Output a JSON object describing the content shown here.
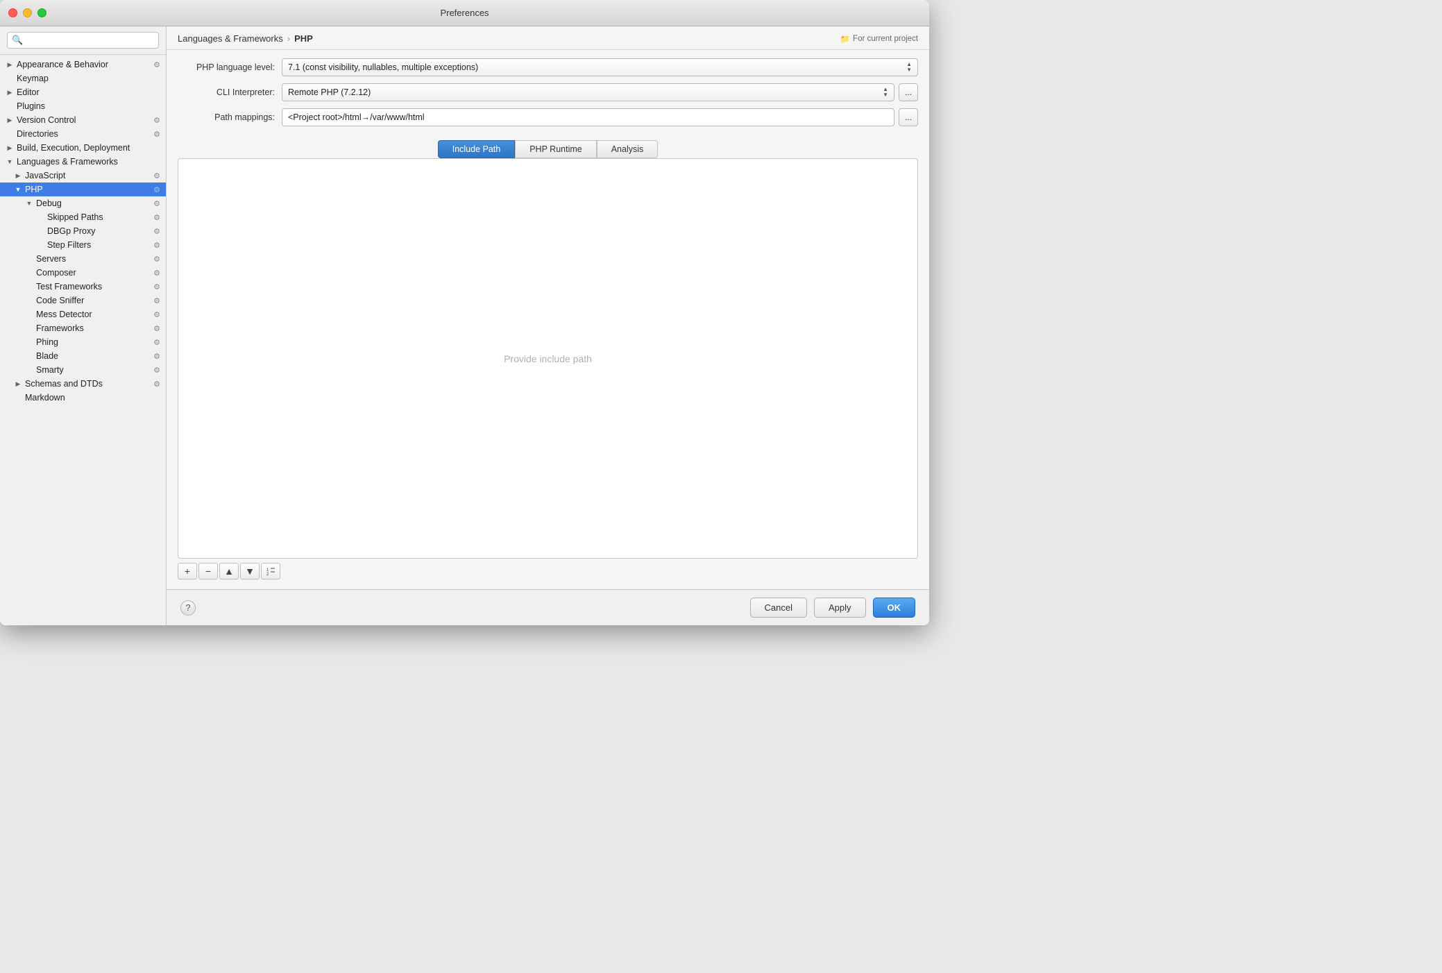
{
  "window": {
    "title": "Preferences"
  },
  "sidebar": {
    "search_placeholder": "🔍",
    "items": [
      {
        "id": "appearance",
        "label": "Appearance & Behavior",
        "level": 0,
        "arrow": "▶",
        "has_icon": true
      },
      {
        "id": "keymap",
        "label": "Keymap",
        "level": 0,
        "arrow": "",
        "has_icon": false
      },
      {
        "id": "editor",
        "label": "Editor",
        "level": 0,
        "arrow": "▶",
        "has_icon": false
      },
      {
        "id": "plugins",
        "label": "Plugins",
        "level": 0,
        "arrow": "",
        "has_icon": false
      },
      {
        "id": "version-control",
        "label": "Version Control",
        "level": 0,
        "arrow": "▶",
        "has_icon": true
      },
      {
        "id": "directories",
        "label": "Directories",
        "level": 0,
        "arrow": "",
        "has_icon": true
      },
      {
        "id": "build",
        "label": "Build, Execution, Deployment",
        "level": 0,
        "arrow": "▶",
        "has_icon": false
      },
      {
        "id": "languages",
        "label": "Languages & Frameworks",
        "level": 0,
        "arrow": "▼",
        "has_icon": false
      },
      {
        "id": "javascript",
        "label": "JavaScript",
        "level": 1,
        "arrow": "▶",
        "has_icon": true
      },
      {
        "id": "php",
        "label": "PHP",
        "level": 1,
        "arrow": "▼",
        "has_icon": true,
        "selected": true
      },
      {
        "id": "debug",
        "label": "Debug",
        "level": 2,
        "arrow": "▼",
        "has_icon": true
      },
      {
        "id": "skipped-paths",
        "label": "Skipped Paths",
        "level": 3,
        "arrow": "",
        "has_icon": true
      },
      {
        "id": "dbgp-proxy",
        "label": "DBGp Proxy",
        "level": 3,
        "arrow": "",
        "has_icon": true
      },
      {
        "id": "step-filters",
        "label": "Step Filters",
        "level": 3,
        "arrow": "",
        "has_icon": true
      },
      {
        "id": "servers",
        "label": "Servers",
        "level": 2,
        "arrow": "",
        "has_icon": true
      },
      {
        "id": "composer",
        "label": "Composer",
        "level": 2,
        "arrow": "",
        "has_icon": true
      },
      {
        "id": "test-frameworks",
        "label": "Test Frameworks",
        "level": 2,
        "arrow": "",
        "has_icon": true
      },
      {
        "id": "code-sniffer",
        "label": "Code Sniffer",
        "level": 2,
        "arrow": "",
        "has_icon": true
      },
      {
        "id": "mess-detector",
        "label": "Mess Detector",
        "level": 2,
        "arrow": "",
        "has_icon": true
      },
      {
        "id": "frameworks",
        "label": "Frameworks",
        "level": 2,
        "arrow": "",
        "has_icon": true
      },
      {
        "id": "phing",
        "label": "Phing",
        "level": 2,
        "arrow": "",
        "has_icon": true
      },
      {
        "id": "blade",
        "label": "Blade",
        "level": 2,
        "arrow": "",
        "has_icon": true
      },
      {
        "id": "smarty",
        "label": "Smarty",
        "level": 2,
        "arrow": "",
        "has_icon": true
      },
      {
        "id": "schemas",
        "label": "Schemas and DTDs",
        "level": 1,
        "arrow": "▶",
        "has_icon": true
      },
      {
        "id": "markdown",
        "label": "Markdown",
        "level": 1,
        "arrow": "",
        "has_icon": false
      }
    ]
  },
  "breadcrumb": {
    "parent": "Languages & Frameworks",
    "separator": "›",
    "current": "PHP",
    "project_label": "For current project"
  },
  "fields": {
    "php_language_level_label": "PHP language level:",
    "php_language_level_value": "7.1 (const visibility, nullables, multiple exceptions)",
    "cli_interpreter_label": "CLI Interpreter:",
    "cli_interpreter_value": "Remote PHP (7.2.12)",
    "path_mappings_label": "Path mappings:",
    "path_mappings_value": "<Project root>/html→/var/www/html"
  },
  "tabs": [
    {
      "id": "include-path",
      "label": "Include Path",
      "active": true
    },
    {
      "id": "php-runtime",
      "label": "PHP Runtime",
      "active": false
    },
    {
      "id": "analysis",
      "label": "Analysis",
      "active": false
    }
  ],
  "include_path": {
    "placeholder": "Provide include path"
  },
  "toolbar": {
    "add": "+",
    "remove": "−",
    "move_up": "▲",
    "move_down": "▼",
    "sort": "1\n2"
  },
  "bottom": {
    "help": "?",
    "cancel": "Cancel",
    "apply": "Apply",
    "ok": "OK"
  }
}
